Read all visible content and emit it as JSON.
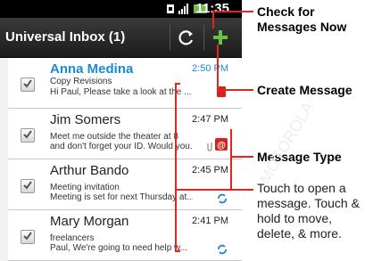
{
  "status_bar": {
    "time": "11:35",
    "icons": [
      "sim-icon",
      "signal-icon",
      "battery-icon"
    ]
  },
  "title_bar": {
    "title": "Universal Inbox (1)",
    "refresh_icon": "refresh-icon",
    "compose_icon": "plus-icon"
  },
  "messages": [
    {
      "sender": "Anna Medina",
      "time": "2:50 PM",
      "line1": "Copy Revisions",
      "line2": "Hi Paul, Please take a look at the ...",
      "unread": true,
      "type_icon": "email-icon"
    },
    {
      "sender": "Jim Somers",
      "time": "2:47 PM",
      "line1": "Meet me outside the theater at 8",
      "line2": "and don't forget your ID. Would you...",
      "unread": false,
      "type_icon": "email-icon"
    },
    {
      "sender": "Arthur Bando",
      "time": "2:45 PM",
      "line1": "Meeting invitation",
      "line2": "Meeting is set for next Thursday at...",
      "unread": false,
      "type_icon": "sync-icon"
    },
    {
      "sender": "Mary Morgan",
      "time": "2:41 PM",
      "line1": "freelancers",
      "line2": "Paul, We're going to need help w...",
      "unread": false,
      "type_icon": "sync-icon"
    }
  ],
  "callouts": {
    "check_messages": [
      "Check for",
      "Messages Now"
    ],
    "create_message": "Create Message",
    "message_type": "Message Type",
    "touch_help": [
      "Touch to open a",
      "message. Touch &",
      "hold to move,",
      "delete, & more."
    ]
  },
  "colors": {
    "accent_blue": "#1a8ad6",
    "callout_red": "#e8231e",
    "compose_green": "#6cc04a",
    "title_bar": "#2a2a2a"
  },
  "watermark": "MOTOROLA"
}
